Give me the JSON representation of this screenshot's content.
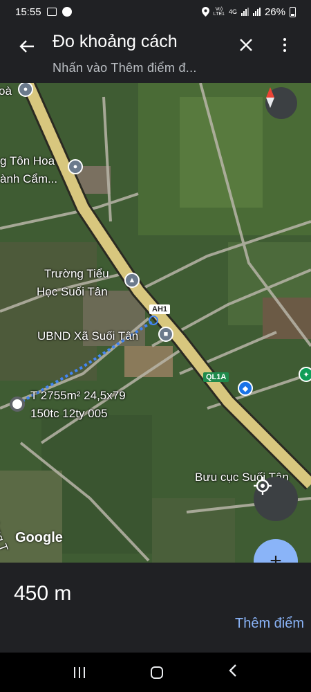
{
  "status_bar": {
    "time": "15:55",
    "network_top": "Vo)",
    "network_bottom": "LTE1",
    "data_type": "4G",
    "battery": "26%"
  },
  "header": {
    "title": "Đo khoảng cách",
    "subtitle": "Nhấn vào Thêm điểm đ..."
  },
  "map": {
    "labels": {
      "hoa_partial": "oà",
      "ton_hoa": "g Tôn Hoa",
      "canh_cam": "ành Cẩm...",
      "school_line1": "Trường Tiểu",
      "school_line2": "Học Suối Tân",
      "ubnd": "UBND Xã Suối Tân",
      "plot_line1": "T 2755m² 24,5x79",
      "plot_line2": "150tc 12ty 005",
      "post_office": "Bưu cục Suối Tân",
      "truong_partial": "ường T",
      "google": "Google"
    },
    "road_shields": {
      "ah1": "AH1",
      "ql1a": "QL1A"
    }
  },
  "measurement": {
    "distance": "450 m",
    "add_point_label": "Thêm điểm"
  }
}
